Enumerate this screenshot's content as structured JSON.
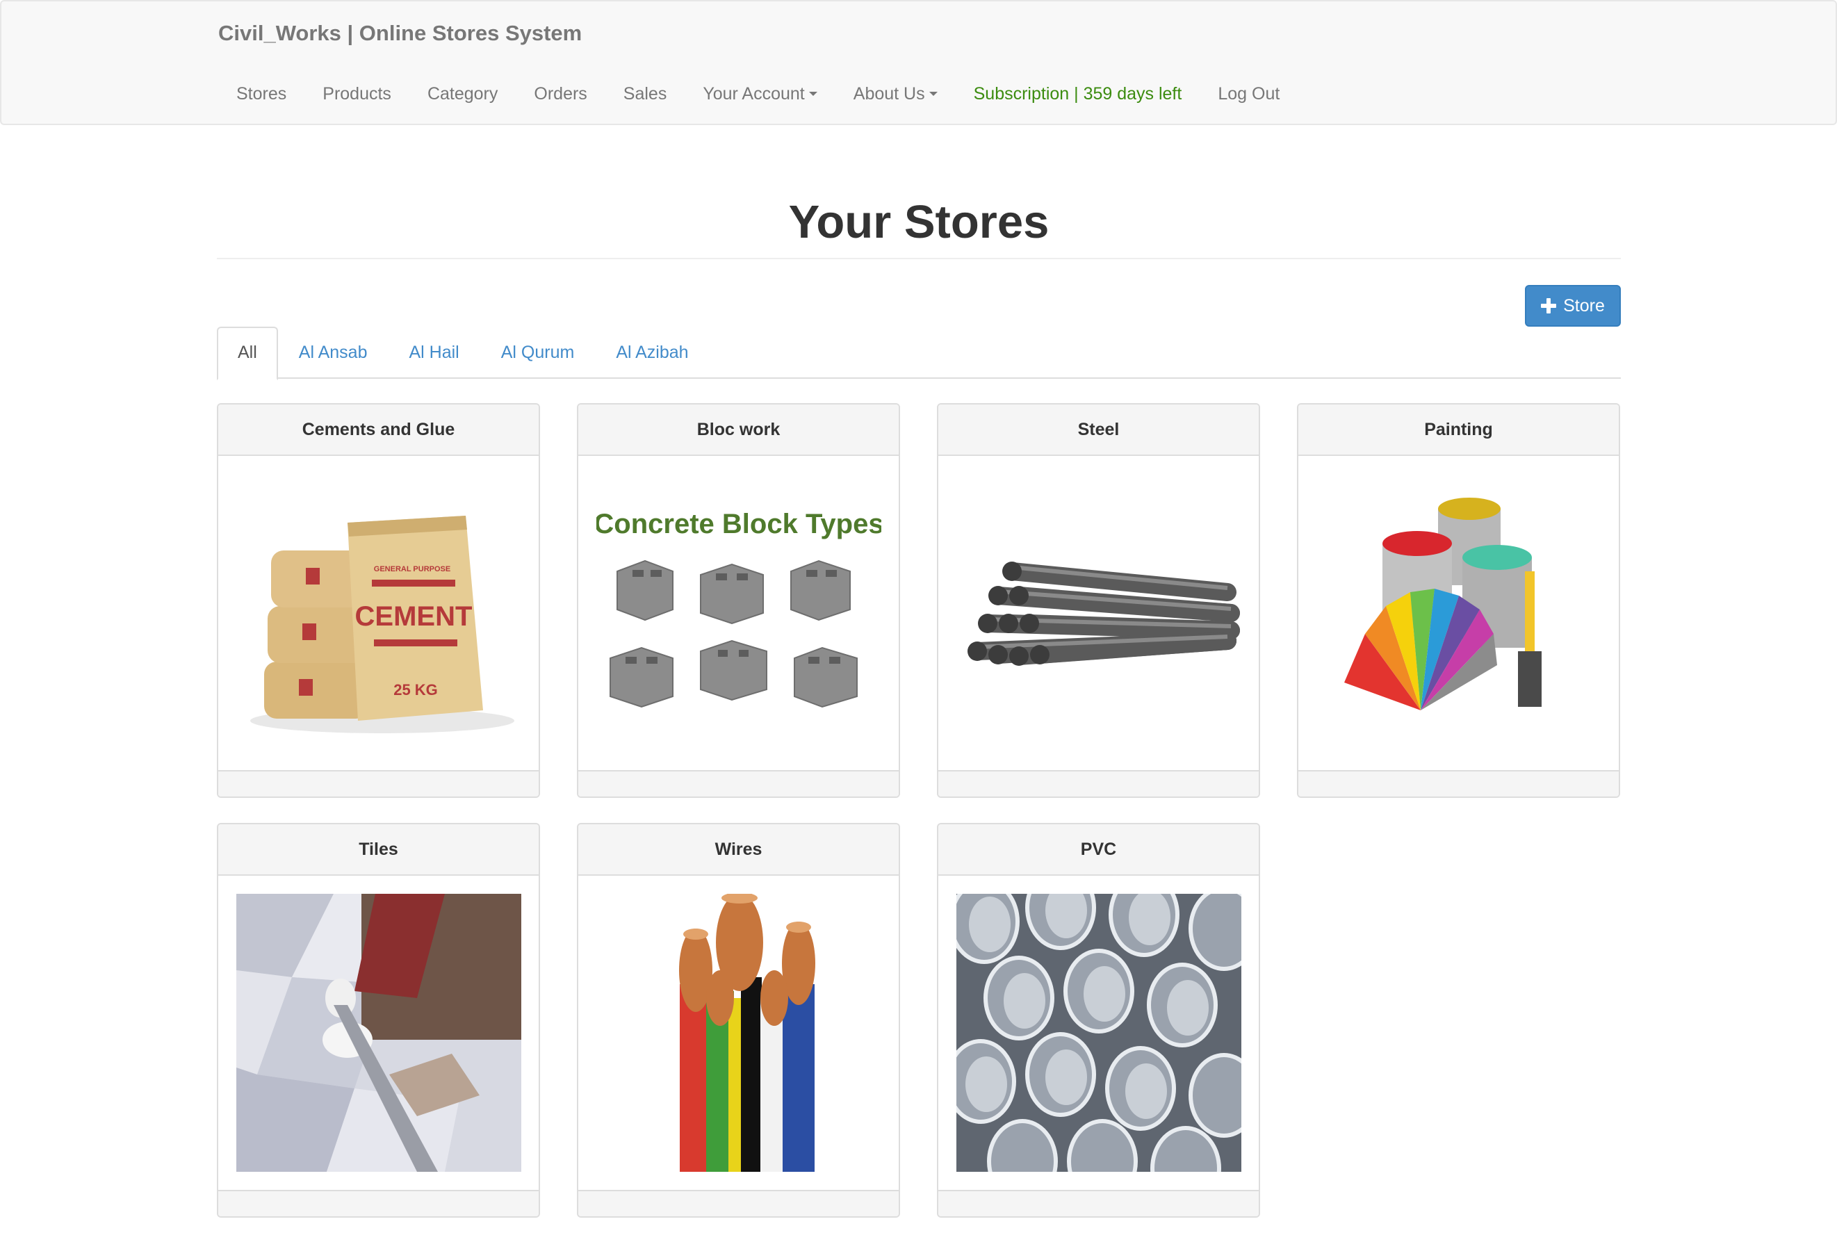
{
  "navbar": {
    "brand": "Civil_Works | Online Stores System",
    "links": [
      {
        "label": "Stores"
      },
      {
        "label": "Products"
      },
      {
        "label": "Category"
      },
      {
        "label": "Orders"
      },
      {
        "label": "Sales"
      },
      {
        "label": "Your Account",
        "dropdown": true
      },
      {
        "label": "About Us",
        "dropdown": true
      },
      {
        "label": "Subscription | 359 days left",
        "color": "#3c8c10"
      },
      {
        "label": "Log Out"
      }
    ]
  },
  "page": {
    "title": "Your Stores",
    "add_button_label": "Store"
  },
  "tabs": [
    {
      "label": "All",
      "active": true
    },
    {
      "label": "Al Ansab"
    },
    {
      "label": "Al Hail"
    },
    {
      "label": "Al Qurum"
    },
    {
      "label": "Al Azibah"
    }
  ],
  "stores": [
    {
      "title": "Cements and Glue",
      "image": "cement-bags"
    },
    {
      "title": "Bloc work",
      "image": "concrete-blocks",
      "image_text": "Concrete Block Types"
    },
    {
      "title": "Steel",
      "image": "steel-rebar"
    },
    {
      "title": "Painting",
      "image": "paint-cans"
    },
    {
      "title": "Tiles",
      "image": "tile-installation"
    },
    {
      "title": "Wires",
      "image": "electric-wires"
    },
    {
      "title": "PVC",
      "image": "pvc-pipes"
    }
  ],
  "image_text": {
    "cement_line1": "GENERAL PURPOSE",
    "cement_line2": "CEMENT",
    "cement_line3": "25 KG"
  },
  "colors": {
    "primary": "#428bca",
    "subscription": "#3c8c10",
    "navbar_bg": "#f8f8f8"
  }
}
